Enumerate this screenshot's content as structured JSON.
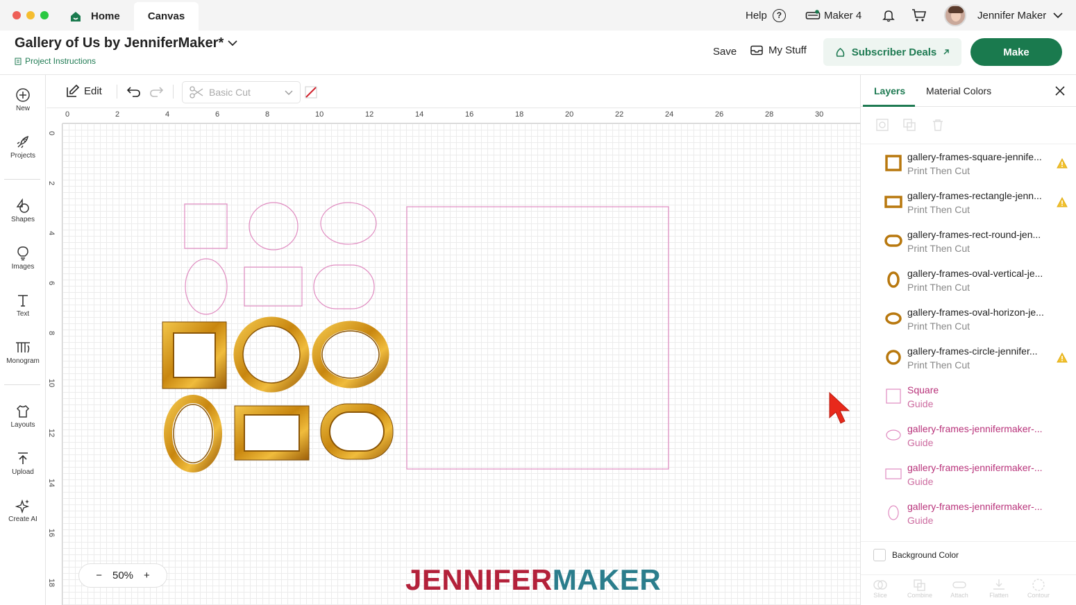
{
  "window": {
    "tabs": [
      {
        "label": "Home"
      },
      {
        "label": "Canvas"
      }
    ],
    "help_label": "Help",
    "help_glyph": "?",
    "machine_label": "Maker 4",
    "user_name": "Jennifer Maker",
    "traffic_light_colors": [
      "#ee5f57",
      "#f5bd2f",
      "#29c840"
    ]
  },
  "project": {
    "title": "Gallery of Us by JenniferMaker*",
    "instructions_link": "Project Instructions",
    "save_label": "Save",
    "my_stuff_label": "My Stuff",
    "subscriber_deals_label": "Subscriber Deals",
    "make_label": "Make"
  },
  "sidebar": {
    "items": [
      {
        "label": "New",
        "icon": "plus-circle-icon"
      },
      {
        "label": "Projects",
        "icon": "rocket-icon"
      },
      {
        "label": "Shapes",
        "icon": "shapes-icon"
      },
      {
        "label": "Images",
        "icon": "lightbulb-icon"
      },
      {
        "label": "Text",
        "icon": "text-icon"
      },
      {
        "label": "Monogram",
        "icon": "monogram-icon"
      },
      {
        "label": "Layouts",
        "icon": "shirt-icon"
      },
      {
        "label": "Upload",
        "icon": "upload-icon"
      },
      {
        "label": "Create AI",
        "icon": "sparkle-icon"
      }
    ]
  },
  "toolbar": {
    "edit_label": "Edit",
    "operation_select": "Basic Cut"
  },
  "ruler": {
    "h_labels": [
      "0",
      "2",
      "4",
      "6",
      "8",
      "10",
      "12",
      "14",
      "16",
      "18",
      "20",
      "22",
      "24",
      "26",
      "28",
      "30"
    ],
    "v_labels": [
      "0",
      "2",
      "4",
      "6",
      "8",
      "10",
      "12",
      "14",
      "16",
      "18"
    ]
  },
  "canvas": {
    "zoom_minus": "−",
    "zoom_level": "50%",
    "zoom_plus": "+",
    "logo_part1": "JENNIFER",
    "logo_part2": "MAKER",
    "brand_colors": {
      "red": "#b3213a",
      "teal": "#2b7d8c",
      "guide_pink": "#e08ac0",
      "gold": "#d99a1f"
    }
  },
  "right_panel": {
    "tab_layers": "Layers",
    "tab_material_colors": "Material Colors",
    "layers": [
      {
        "name": "gallery-frames-square-jennife...",
        "type": "Print Then Cut",
        "shape": "square",
        "kind": "print",
        "warning": true
      },
      {
        "name": "gallery-frames-rectangle-jenn...",
        "type": "Print Then Cut",
        "shape": "rect",
        "kind": "print",
        "warning": true
      },
      {
        "name": "gallery-frames-rect-round-jen...",
        "type": "Print Then Cut",
        "shape": "rectround",
        "kind": "print",
        "warning": false
      },
      {
        "name": "gallery-frames-oval-vertical-je...",
        "type": "Print Then Cut",
        "shape": "ovalv",
        "kind": "print",
        "warning": false
      },
      {
        "name": "gallery-frames-oval-horizon-je...",
        "type": "Print Then Cut",
        "shape": "ovalh",
        "kind": "print",
        "warning": false
      },
      {
        "name": "gallery-frames-circle-jennifer...",
        "type": "Print Then Cut",
        "shape": "circle",
        "kind": "print",
        "warning": true
      },
      {
        "name": "Square",
        "type": "Guide",
        "shape": "square",
        "kind": "guide",
        "warning": false
      },
      {
        "name": "gallery-frames-jennifermaker-...",
        "type": "Guide",
        "shape": "ovalh",
        "kind": "guide",
        "warning": false
      },
      {
        "name": "gallery-frames-jennifermaker-...",
        "type": "Guide",
        "shape": "rect",
        "kind": "guide",
        "warning": false
      },
      {
        "name": "gallery-frames-jennifermaker-...",
        "type": "Guide",
        "shape": "ovalv",
        "kind": "guide",
        "warning": false
      }
    ],
    "background_color_label": "Background Color",
    "bottom_actions": [
      {
        "label": "Slice",
        "icon": "slice-icon"
      },
      {
        "label": "Combine",
        "icon": "combine-icon"
      },
      {
        "label": "Attach",
        "icon": "attach-icon"
      },
      {
        "label": "Flatten",
        "icon": "flatten-icon"
      },
      {
        "label": "Contour",
        "icon": "contour-icon"
      }
    ]
  }
}
